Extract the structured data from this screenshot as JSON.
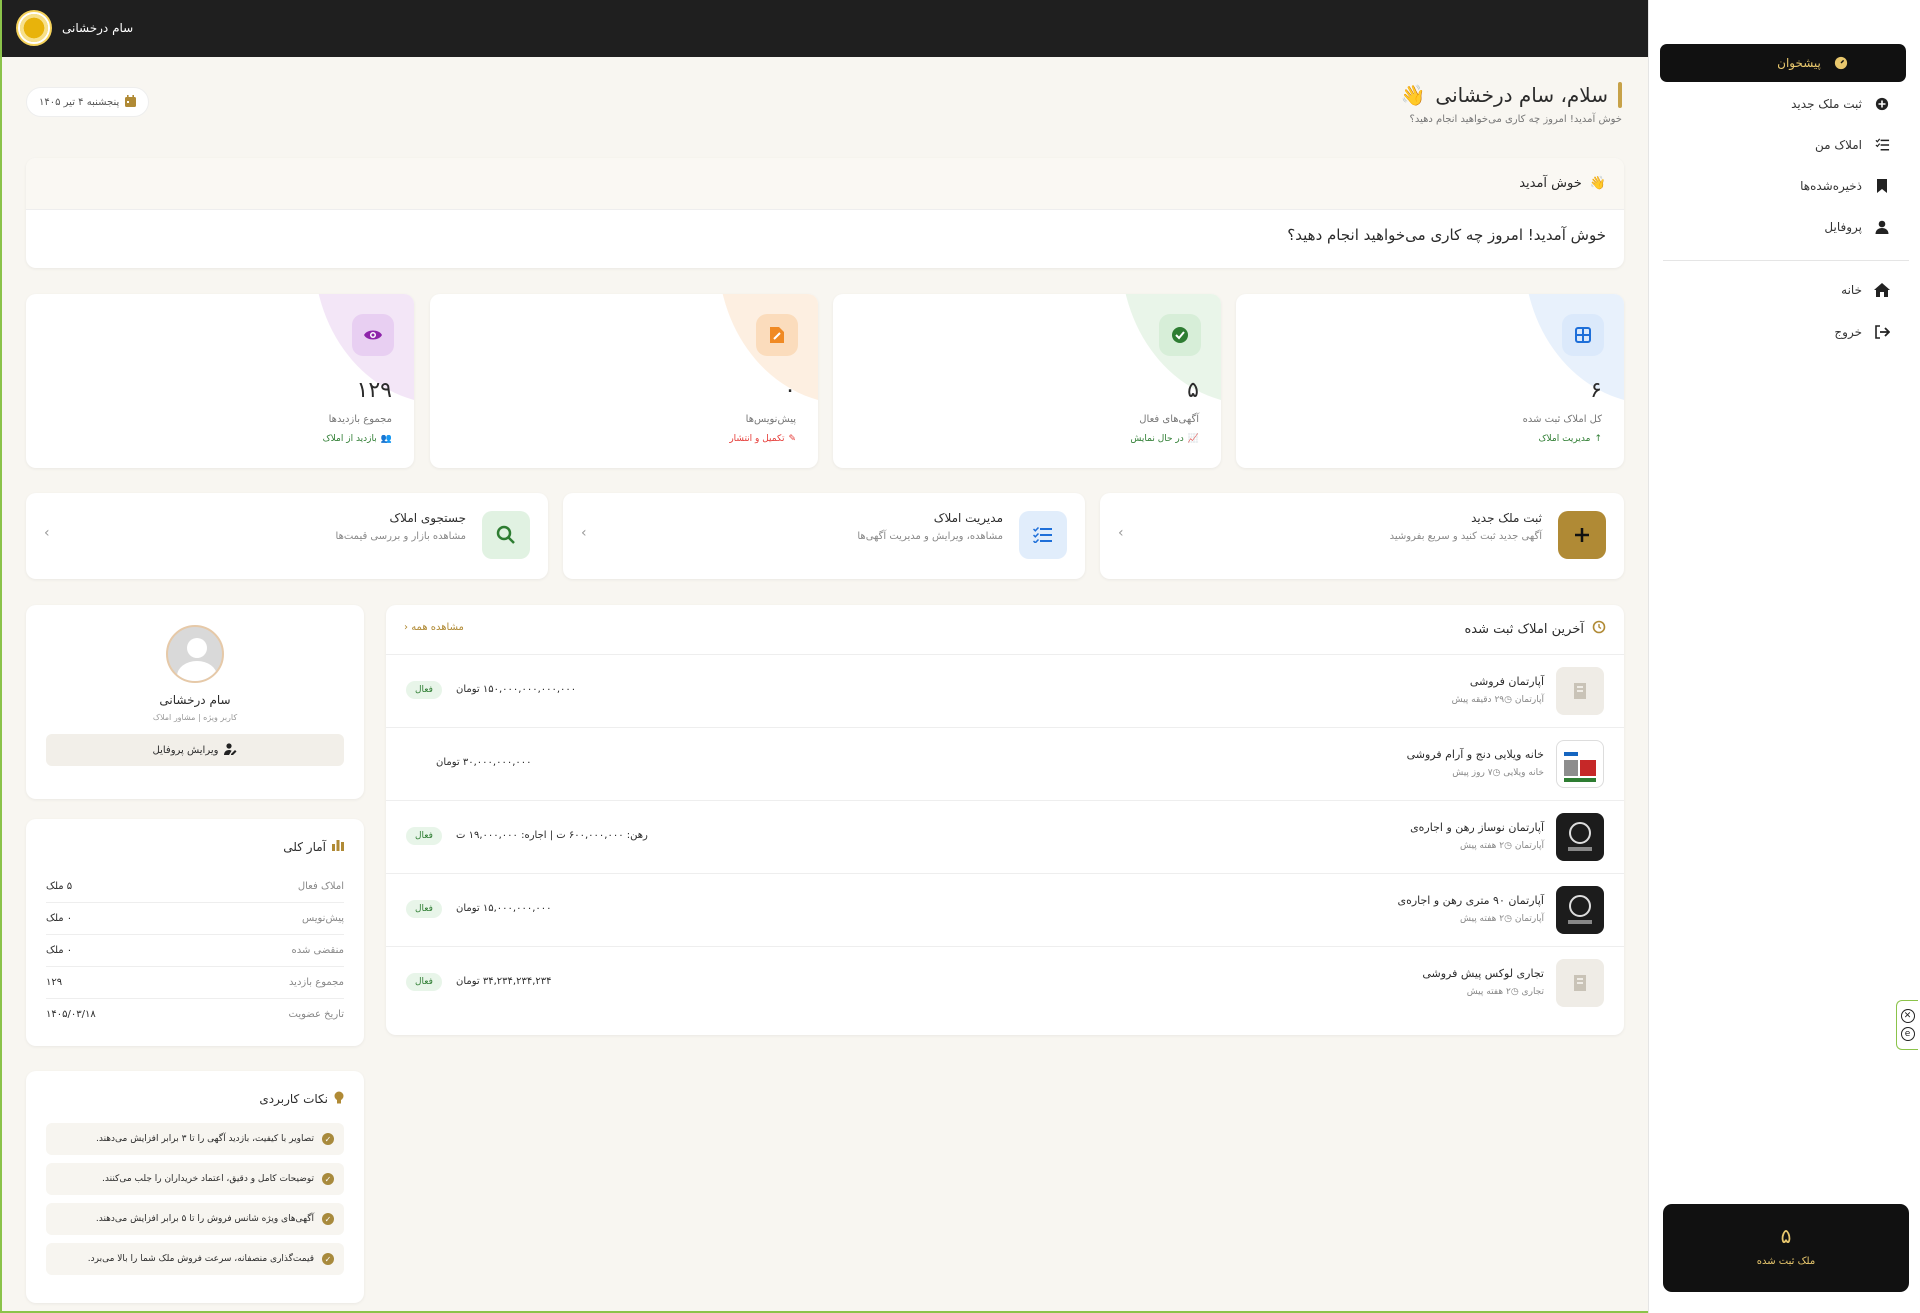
{
  "header": {
    "user_name": "سام درخشانی"
  },
  "sidebar": {
    "items": [
      {
        "label": "پیشخوان"
      },
      {
        "label": "ثبت ملک جدید"
      },
      {
        "label": "املاک من"
      },
      {
        "label": "ذخیره‌شده‌ها"
      },
      {
        "label": "پروفایل"
      },
      {
        "label": "خانه"
      },
      {
        "label": "خروج"
      }
    ],
    "count_value": "۵",
    "count_label": "ملک ثبت شده"
  },
  "greeting": {
    "title": "سلام، سام درخشانی",
    "emoji": "👋",
    "subtitle": "خوش آمدید! امروز چه کاری می‌خواهید انجام دهید؟",
    "date": "پنجشنبه ۴ تیر ۱۴۰۵"
  },
  "welcome": {
    "title": "خوش آمدید",
    "body": "خوش آمدید! امروز چه کاری می‌خواهید انجام دهید؟"
  },
  "stats": [
    {
      "value": "۶",
      "label": "کل املاک ثبت شده",
      "sub": "مدیریت املاک",
      "color": "#1e6fd9",
      "bg": "#e8f1fc",
      "subcolor": "#2e7d32",
      "icon": "grid-icon"
    },
    {
      "value": "۵",
      "label": "آگهی‌های فعال",
      "sub": "در حال نمایش",
      "color": "#2e7d32",
      "bg": "#e9f5e9",
      "subcolor": "#2e7d32",
      "icon": "check-icon"
    },
    {
      "value": "۰",
      "label": "پیش‌نویس‌ها",
      "sub": "تکمیل و انتشار",
      "color": "#f08a24",
      "bg": "#fdefe1",
      "subcolor": "#e53935",
      "icon": "draft-icon"
    },
    {
      "value": "۱۲۹",
      "label": "مجموع بازدیدها",
      "sub": "بازدید از املاک",
      "color": "#8e24aa",
      "bg": "#f3e6f7",
      "subcolor": "#2e7d32",
      "icon": "eye-icon"
    }
  ],
  "actions": [
    {
      "title": "ثبت ملک جدید",
      "sub": "آگهی جدید ثبت کنید و سریع بفروشید",
      "icon": "plus-icon"
    },
    {
      "title": "مدیریت املاک",
      "sub": "مشاهده، ویرایش و مدیریت آگهی‌ها",
      "icon": "list-icon"
    },
    {
      "title": "جستجوی املاک",
      "sub": "مشاهده بازار و بررسی قیمت‌ها",
      "icon": "search-icon"
    }
  ],
  "recent": {
    "title": "آخرین املاک ثبت شده",
    "view_all": "مشاهده همه",
    "rows": [
      {
        "name": "آپارتمان فروشی",
        "type": "آپارتمان",
        "time": "۲۹ دقیقه پیش",
        "price": "۱۵۰,۰۰۰,۰۰۰,۰۰۰,۰۰۰ تومان",
        "badge": "فعال"
      },
      {
        "name": "خانه ویلایی دنج و آرام فروشی",
        "type": "خانه ویلایی",
        "time": "۷ روز پیش",
        "price": "۳۰,۰۰۰,۰۰۰,۰۰۰ تومان",
        "badge": ""
      },
      {
        "name": "آپارتمان نوساز رهن و اجاره‌ی",
        "type": "آپارتمان",
        "time": "۲ هفته پیش",
        "price": "رهن: ۶۰۰,۰۰۰,۰۰۰ ت | اجاره: ۱۹,۰۰۰,۰۰۰ ت",
        "badge": "فعال"
      },
      {
        "name": "آپارتمان ۹۰ متری رهن و اجاره‌ی",
        "type": "آپارتمان",
        "time": "۲ هفته پیش",
        "price": "۱۵,۰۰۰,۰۰۰,۰۰۰ تومان",
        "badge": "فعال"
      },
      {
        "name": "تجاری لوکس پیش فروشی",
        "type": "تجاری",
        "time": "۲ هفته پیش",
        "price": "۳۴,۲۳۴,۲۳۴,۲۳۴ تومان",
        "badge": "فعال"
      }
    ]
  },
  "profile": {
    "name": "سام درخشانی",
    "role": "کاربر ویژه | مشاور املاک",
    "edit": "ویرایش پروفایل"
  },
  "summary": {
    "title": "آمار کلی",
    "rows": [
      {
        "k": "املاک فعال",
        "v": "۵ ملک"
      },
      {
        "k": "پیش‌نویس",
        "v": "۰ ملک"
      },
      {
        "k": "منقضی شده",
        "v": "۰ ملک"
      },
      {
        "k": "مجموع بازدید",
        "v": "۱۲۹"
      },
      {
        "k": "تاریخ عضویت",
        "v": "۱۴۰۵/۰۳/۱۸"
      }
    ]
  },
  "tips": {
    "title": "نکات کاربردی",
    "items": [
      "تصاویر با کیفیت، بازدید آگهی را تا ۳ برابر افزایش می‌دهند.",
      "توضیحات کامل و دقیق، اعتماد خریداران را جلب می‌کنند.",
      "آگهی‌های ویژه شانس فروش را تا ۵ برابر افزایش می‌دهند.",
      "قیمت‌گذاری منصفانه، سرعت فروش ملک شما را بالا می‌برد."
    ]
  }
}
